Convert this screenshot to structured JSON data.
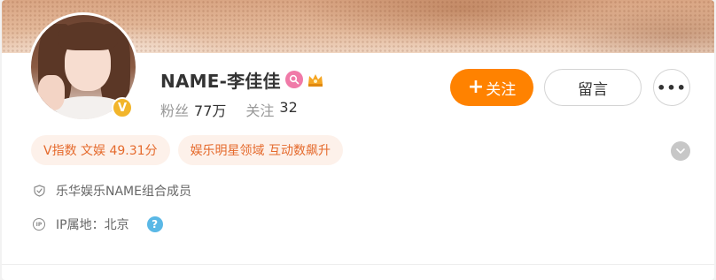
{
  "profile": {
    "name": "NAME-李佳佳",
    "verify_mark": "V",
    "badges": [
      "pink-search-badge-icon",
      "crown-badge-icon"
    ],
    "stats": [
      {
        "label": "粉丝",
        "value": "77万"
      },
      {
        "label": "关注",
        "value": "32"
      }
    ]
  },
  "actions": {
    "follow_plus": "+",
    "follow_label": "关注",
    "message_label": "留言",
    "more_label": "•••"
  },
  "tags": [
    {
      "label": "V指数 文娱 49.31分"
    },
    {
      "label": "娱乐明星领域 互动数飙升"
    }
  ],
  "info": {
    "intro": "乐华娱乐NAME组合成员",
    "ip_icon_text": "IP",
    "ip_location": "IP属地：北京",
    "help": "?"
  },
  "colors": {
    "accent": "#ff8200",
    "tag_bg": "#fdf1ea",
    "tag_text": "#e56a2c",
    "verify": "#f2b52b",
    "help": "#5ab8e6"
  }
}
